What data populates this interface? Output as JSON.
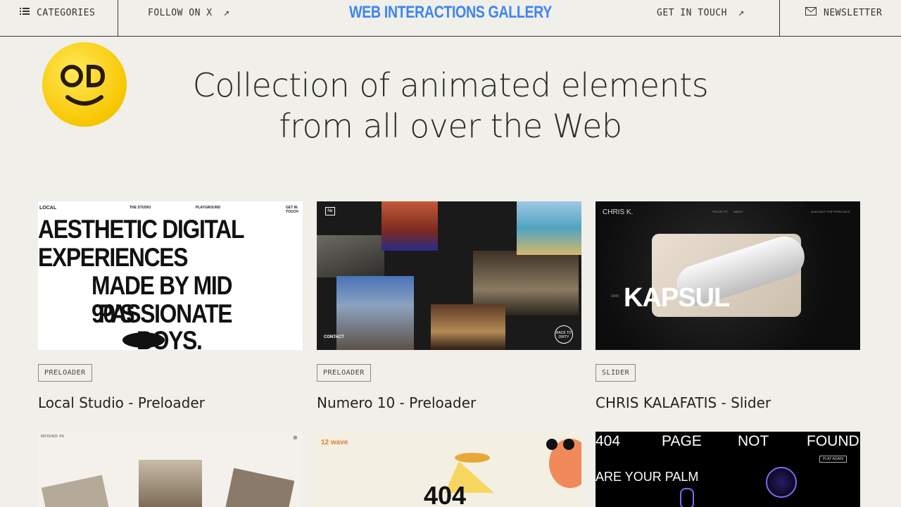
{
  "header": {
    "categories_label": "CATEGORIES",
    "follow_label": "FOLLOW ON X",
    "brand": "WEB INTERACTIONS GALLERY",
    "contact_label": "GET IN TOUCH",
    "newsletter_label": "NEWSLETTER"
  },
  "hero": {
    "line1": "Collection of animated elements",
    "line2": "from all over the Web"
  },
  "cards": [
    {
      "tag": "PRELOADER",
      "title": "Local Studio - Preloader",
      "thumb": {
        "brand": "LOCAL",
        "nav": [
          "THE STUDIO",
          "PLAYGROUND",
          "GET IN TOUCH"
        ],
        "lines": [
          "AESTHETIC DIGITAL",
          "EXPERIENCES",
          "MADE BY MID 90’S",
          "PASSIONATE",
          "BOYS."
        ]
      }
    },
    {
      "tag": "PRELOADER",
      "title": "Numero 10 - Preloader",
      "thumb": {
        "logo": "№",
        "contact": "CONTACT",
        "badge": "BACK TO DIRTY"
      }
    },
    {
      "tag": "SLIDER",
      "title": "CHRIS KALAFATIS - Slider",
      "thumb": {
        "brand": "CHRIS K.",
        "nav": [
          "PROJECTS",
          "ABOUT"
        ],
        "status": "AVAILABLE FOR FREELANCE",
        "product": "KAPSUL",
        "index": "0045"
      }
    }
  ],
  "row2": [
    {
      "brand": "M/FISHER",
      "count": "4%"
    },
    {
      "brand": "12 wave",
      "text": "404"
    },
    {
      "words": [
        "404",
        "PAGE",
        "NOT",
        "FOUND"
      ],
      "sub": "ARE YOUR PALM",
      "button": "PLAY AGAIN"
    }
  ],
  "colors": {
    "brand": "#3d86f0",
    "background": "#f0efea"
  }
}
